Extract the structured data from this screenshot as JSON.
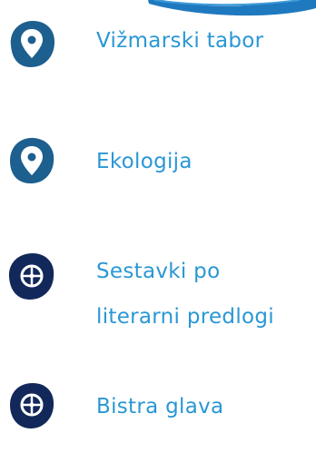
{
  "items": [
    {
      "label": "Vižmarski tabor",
      "icon": "location-pin-icon",
      "color": "#1d5f8f"
    },
    {
      "label": "Ekologija",
      "icon": "location-pin-icon",
      "color": "#1d5f8f"
    },
    {
      "label_line1": "Sestavki po",
      "label_line2": "literarni predlogi",
      "icon": "wheel-icon",
      "color": "#13285a"
    },
    {
      "label": "Bistra glava",
      "icon": "wheel-icon",
      "color": "#13285a"
    }
  ],
  "colors": {
    "label": "#2a97d4",
    "brush": "#1f79bf"
  }
}
